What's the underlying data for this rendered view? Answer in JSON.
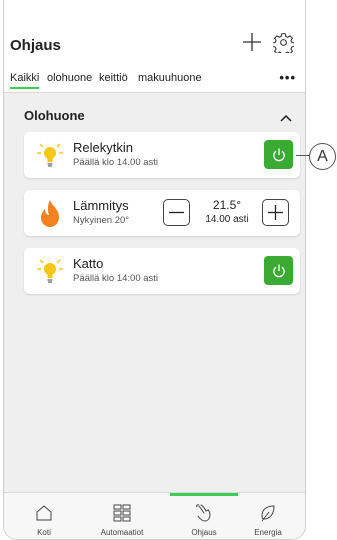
{
  "header": {
    "title": "Ohjaus",
    "add_icon": "plus-icon",
    "settings_icon": "gear-icon"
  },
  "tabs": [
    {
      "label": "Kaikki",
      "active": true
    },
    {
      "label": "olohuone",
      "active": false
    },
    {
      "label": "keittiö",
      "active": false
    },
    {
      "label": "makuuhuone",
      "active": false
    }
  ],
  "more_label": "•••",
  "section": {
    "title": "Olohuone",
    "collapse_icon": "chevron-up-icon"
  },
  "devices": [
    {
      "name": "Relekytkin",
      "status": "Päällä klo 14.00 asti",
      "icon": "bulb-icon",
      "control": "power",
      "on": true
    },
    {
      "name": "Lämmitys",
      "status": "Nykyinen 20°",
      "icon": "flame-icon",
      "control": "stepper",
      "setpoint": "21.5°",
      "until": "14.00 asti"
    },
    {
      "name": "Katto",
      "status": "Päällä klo 14:00 asti",
      "icon": "bulb-icon",
      "control": "power",
      "on": true
    }
  ],
  "callout_label": "A",
  "nav": [
    {
      "label": "Koti",
      "icon": "home-icon",
      "active": false
    },
    {
      "label": "Automaatiot",
      "icon": "grid-icon",
      "active": false
    },
    {
      "label": "Ohjaus",
      "icon": "hand-icon",
      "active": true
    },
    {
      "label": "Energia",
      "icon": "leaf-icon",
      "active": false
    }
  ],
  "colors": {
    "accent_green": "#3dcd58",
    "power_green": "#3aaa35",
    "bulb_yellow": "#f5c518",
    "flame_orange": "#f58220"
  }
}
